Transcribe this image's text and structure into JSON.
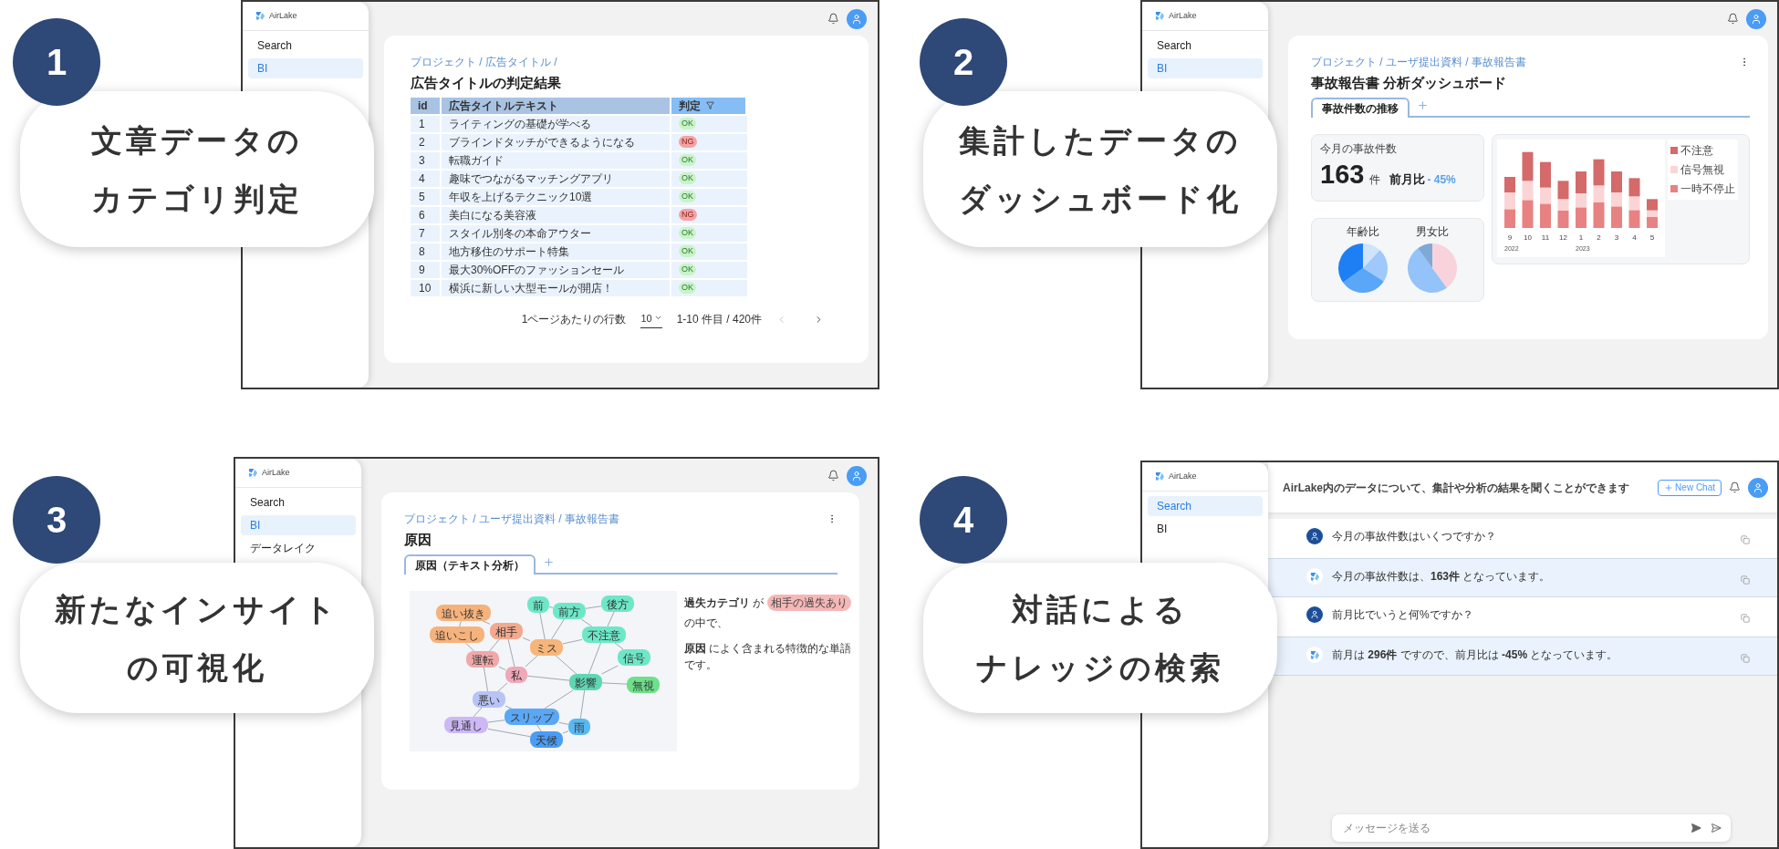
{
  "panels": [
    {
      "kind": "table",
      "number": "1",
      "caption": [
        "文章データの",
        "カテゴリ判定"
      ],
      "screen": {
        "logo": "AirLake",
        "nav": [
          {
            "label": "Search",
            "selected": false
          },
          {
            "label": "BI",
            "selected": true
          }
        ],
        "breadcrumb": "プロジェクト / 広告タイトル /",
        "title": "広告タイトルの判定結果",
        "table": {
          "columns": [
            "id",
            "広告タイトルテキスト",
            "判定"
          ],
          "rows": [
            {
              "id": "1",
              "text": "ライティングの基礎が学べる",
              "verdict": {
                "text": "OK",
                "kind": "ok"
              }
            },
            {
              "id": "2",
              "text": "ブラインドタッチができるようになる",
              "verdict": {
                "text": "NG",
                "kind": "ng"
              }
            },
            {
              "id": "3",
              "text": "転職ガイド",
              "verdict": {
                "text": "OK",
                "kind": "ok"
              }
            },
            {
              "id": "4",
              "text": "趣味でつながるマッチングアプリ",
              "verdict": {
                "text": "OK",
                "kind": "ok"
              }
            },
            {
              "id": "5",
              "text": "年収を上げるテクニック10選",
              "verdict": {
                "text": "OK",
                "kind": "ok"
              }
            },
            {
              "id": "6",
              "text": "美白になる美容液",
              "verdict": {
                "text": "NG",
                "kind": "ng"
              }
            },
            {
              "id": "7",
              "text": "スタイル別冬の本命アウター",
              "verdict": {
                "text": "OK",
                "kind": "ok"
              }
            },
            {
              "id": "8",
              "text": "地方移住のサポート特集",
              "verdict": {
                "text": "OK",
                "kind": "ok"
              }
            },
            {
              "id": "9",
              "text": "最大30%OFFのファッションセール",
              "verdict": {
                "text": "OK",
                "kind": "ok"
              }
            },
            {
              "id": "10",
              "text": "横浜に新しい大型モールが開店！",
              "verdict": {
                "text": "OK",
                "kind": "ok"
              }
            }
          ]
        },
        "pagination": {
          "rows_per_page_label": "1ページあたりの行数",
          "rows_per_page": "10",
          "range": "1-10 件目 / 420件"
        }
      }
    },
    {
      "kind": "dashboard",
      "number": "2",
      "caption": [
        "集計したデータの",
        "ダッシュボード化"
      ],
      "screen": {
        "logo": "AirLake",
        "nav": [
          {
            "label": "Search",
            "selected": false
          },
          {
            "label": "BI",
            "selected": true
          }
        ],
        "breadcrumb": "プロジェクト / ユーザ提出資料 / 事故報告書",
        "title": "事故報告書 分析ダッシュボード",
        "tabs": [
          {
            "label": "事故件数の推移",
            "selected": true
          }
        ],
        "stat": {
          "label": "今月の事故件数",
          "value": "163",
          "unit": "件",
          "compare_label": "前月比",
          "change": "- 45%"
        },
        "pies": [
          {
            "title": "年齢比"
          },
          {
            "title": "男女比"
          }
        ],
        "bar_chart": {
          "x_labels": [
            "9",
            "10",
            "11",
            "12",
            "1",
            "2",
            "3",
            "4",
            "5"
          ],
          "year_labels": [
            "2022",
            "2023"
          ],
          "legend": [
            {
              "label": "不注意",
              "color": "#d46a6a"
            },
            {
              "label": "信号無視",
              "color": "#fbd5d5"
            },
            {
              "label": "一時不停止",
              "color": "#e88282"
            }
          ]
        }
      }
    },
    {
      "kind": "network",
      "number": "3",
      "caption": [
        "新たなインサイト",
        "の可視化"
      ],
      "screen": {
        "logo": "AirLake",
        "nav": [
          {
            "label": "Search",
            "selected": false
          },
          {
            "label": "BI",
            "selected": true
          },
          {
            "label": "データレイク",
            "selected": false
          }
        ],
        "breadcrumb": "プロジェクト / ユーザ提出資料 / 事故報告書",
        "title": "原因",
        "tabs": [
          {
            "label": "原因（テキスト分析）",
            "selected": true
          }
        ],
        "graph": {
          "nodes": [
            {
              "label": "追い抜き",
              "color": "#f5b27c"
            },
            {
              "label": "前",
              "color": "#6ee7c8"
            },
            {
              "label": "前方",
              "color": "#6ee7c8"
            },
            {
              "label": "後方",
              "color": "#6ee7c8"
            },
            {
              "label": "追いこし",
              "color": "#f5b27c"
            },
            {
              "label": "相手",
              "color": "#f2a98e"
            },
            {
              "label": "不注意",
              "color": "#6ee7c8"
            },
            {
              "label": "運転",
              "color": "#f0a8a8"
            },
            {
              "label": "ミス",
              "color": "#f7b57a"
            },
            {
              "label": "信号",
              "color": "#6ee7c8"
            },
            {
              "label": "私",
              "color": "#f0a8b8"
            },
            {
              "label": "影響",
              "color": "#5fd6b4"
            },
            {
              "label": "無視",
              "color": "#6ee08a"
            },
            {
              "label": "悪い",
              "color": "#b8c4f5"
            },
            {
              "label": "見通し",
              "color": "#cdb8f5"
            },
            {
              "label": "スリップ",
              "color": "#5aa8f5"
            },
            {
              "label": "雨",
              "color": "#5ab8f0"
            },
            {
              "label": "天候",
              "color": "#4a9cf5"
            }
          ]
        },
        "description": {
          "before": "**過失カテゴリ** が",
          "tag": "相手の過失あり",
          "after": "の中で、",
          "line2": "**原因** によく含まれる特徴的な単語です。"
        }
      }
    },
    {
      "kind": "chat",
      "number": "4",
      "caption": [
        "対話による",
        "ナレッジの検索"
      ],
      "screen": {
        "logo": "AirLake",
        "nav": [
          {
            "label": "Search",
            "selected": true
          },
          {
            "label": "BI",
            "selected": false
          }
        ],
        "header_title": "AirLake内のデータについて、集計や分析の結果を聞くことができます",
        "new_chat": "New Chat",
        "messages": [
          {
            "kind": "user",
            "text": "今月の事故件数はいくつですか？"
          },
          {
            "kind": "bot",
            "text": "今月の事故件数は、**163件** となっています。"
          },
          {
            "kind": "user",
            "text": "前月比でいうと何%ですか？"
          },
          {
            "kind": "bot",
            "text": "前月は **296件** ですので、前月比は **-45%** となっています。"
          }
        ],
        "input": {
          "placeholder": "メッセージを送る"
        }
      }
    }
  ]
}
